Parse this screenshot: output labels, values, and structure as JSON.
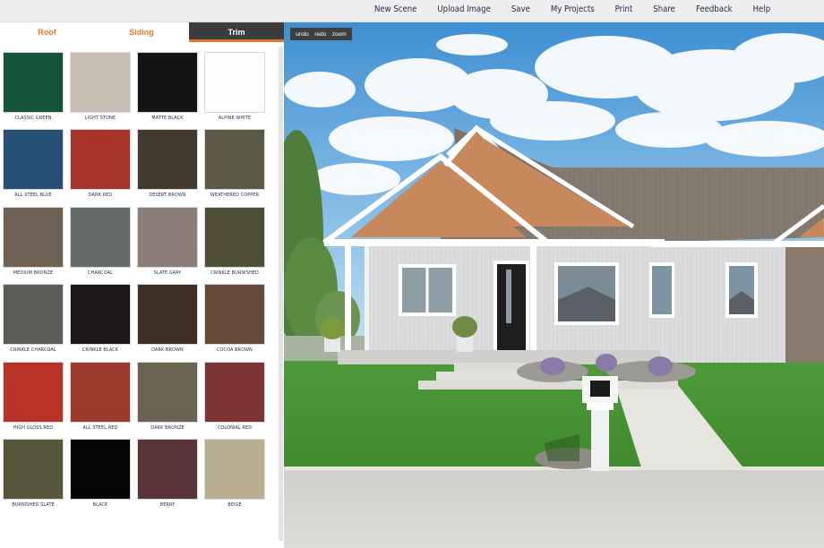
{
  "nav": {
    "items": [
      "New Scene",
      "Upload Image",
      "Save",
      "My Projects",
      "Print",
      "Share",
      "Feedback",
      "Help"
    ]
  },
  "tabs": {
    "roof": "Roof",
    "siding": "Siding",
    "trim": "Trim",
    "active": "Trim"
  },
  "tools": {
    "undo": "undo",
    "redo": "redo",
    "zoom": "zoom"
  },
  "swatches": [
    {
      "name": "CLASSIC GREEN",
      "color": "#14553a"
    },
    {
      "name": "LIGHT STONE",
      "color": "#c6bfb2"
    },
    {
      "name": "MATTE BLACK",
      "color": "#141414"
    },
    {
      "name": "ALPINE WHITE",
      "color": "#fdfdfd"
    },
    {
      "name": "ALL STEEL BLUE",
      "color": "#264f75"
    },
    {
      "name": "DARK RED",
      "color": "#a7342b"
    },
    {
      "name": "DESERT BROWN",
      "color": "#433a2f"
    },
    {
      "name": "WEATHERED COPPER",
      "color": "#5b5845"
    },
    {
      "name": "MEDIUM BRONZE",
      "color": "#6e6153"
    },
    {
      "name": "CHARCOAL",
      "color": "#656a6a"
    },
    {
      "name": "SLATE GRAY",
      "color": "#8b7e76"
    },
    {
      "name": "CRINKLE BURNISHED",
      "color": "#4f4f36"
    },
    {
      "name": "CRINKLE CHARCOAL",
      "color": "#5c5c58"
    },
    {
      "name": "CRINKLE BLACK",
      "color": "#1b1617"
    },
    {
      "name": "DARK BROWN",
      "color": "#3e2e24"
    },
    {
      "name": "COCOA BROWN",
      "color": "#664a38"
    },
    {
      "name": "HIGH GLOSS RED",
      "color": "#b83228"
    },
    {
      "name": "ALL STEEL RED",
      "color": "#9b3b2e"
    },
    {
      "name": "DARK BRONZE",
      "color": "#6c6453"
    },
    {
      "name": "COLONIAL RED",
      "color": "#7c3532"
    },
    {
      "name": "BURNISHED SLATE",
      "color": "#59563e"
    },
    {
      "name": "BLACK",
      "color": "#050505"
    },
    {
      "name": "BERRY",
      "color": "#5b3439"
    },
    {
      "name": "BEIGE",
      "color": "#bbad90"
    }
  ],
  "colors": {
    "accent": "#e77728",
    "nav_text": "#1c2a4a",
    "tab_active_bg": "#3c3c3c",
    "roof_color": "#857a6f",
    "gable_color": "#c98a5d",
    "siding_color": "#d9d9db",
    "trim_color": "#ffffff"
  }
}
